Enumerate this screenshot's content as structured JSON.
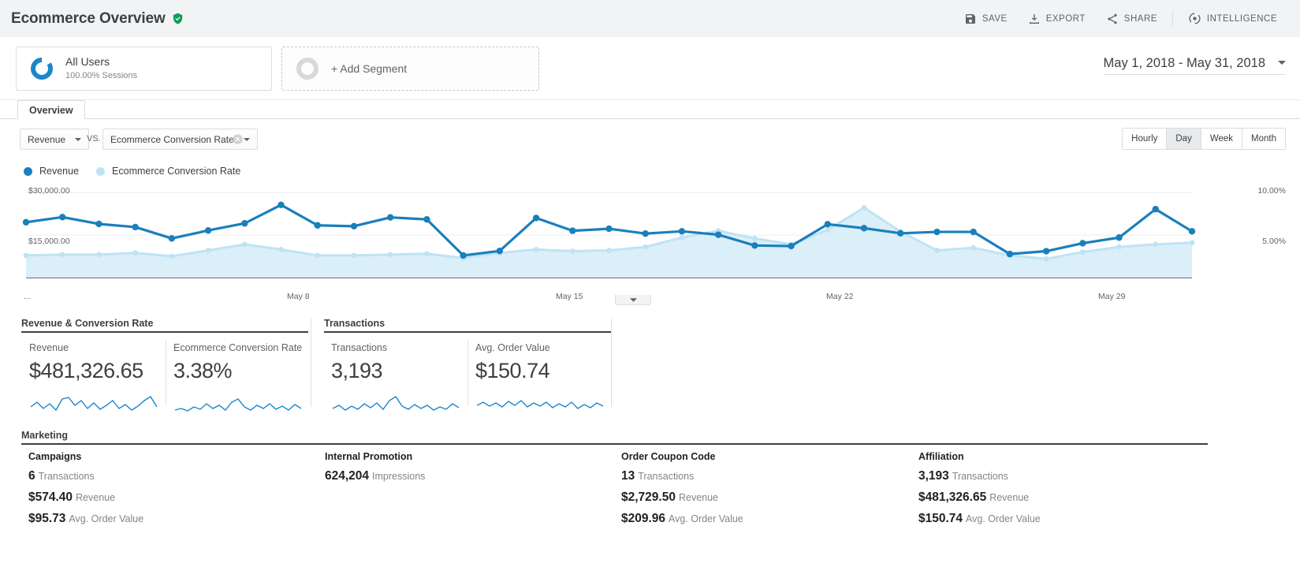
{
  "header": {
    "title": "Ecommerce Overview",
    "verified_icon": "verified-shield-icon",
    "actions": [
      {
        "label": "SAVE",
        "icon": "save-disk-icon"
      },
      {
        "label": "EXPORT",
        "icon": "export-download-icon"
      },
      {
        "label": "SHARE",
        "icon": "share-nodes-icon"
      },
      {
        "label": "INTELLIGENCE",
        "icon": "intelligence-sparkle-icon"
      }
    ]
  },
  "segments": {
    "all_users": {
      "title": "All Users",
      "subtitle": "100.00% Sessions",
      "icon": "donut-chart-icon"
    },
    "add_segment": {
      "label": "+ Add Segment",
      "icon": "empty-donut-icon"
    }
  },
  "date_range": {
    "value": "May 1, 2018 - May 31, 2018",
    "caret": "chevron-down-icon"
  },
  "tabs": [
    {
      "label": "Overview",
      "active": true
    }
  ],
  "controls": {
    "metric1": "Revenue",
    "vs": "VS.",
    "metric2": "Ecommerce Conversion Rate",
    "clear_icon": "clear-circle-icon",
    "granularity": [
      {
        "label": "Hourly",
        "active": false
      },
      {
        "label": "Day",
        "active": true
      },
      {
        "label": "Week",
        "active": false
      },
      {
        "label": "Month",
        "active": false
      }
    ]
  },
  "legend": [
    {
      "label": "Revenue",
      "color": "#1a7fbd"
    },
    {
      "label": "Ecommerce Conversion Rate",
      "color": "#bfe3f5"
    }
  ],
  "chart_data": {
    "type": "line",
    "title": "Revenue vs. Ecommerce Conversion Rate",
    "xlabel": "",
    "ylabel": "Revenue",
    "y2label": "Ecommerce Conversion Rate",
    "grid": true,
    "legend_position": "top-left",
    "ylim": [
      0,
      30000
    ],
    "y2lim": [
      0,
      10
    ],
    "y_ticks": [
      "$15,000.00",
      "$30,000.00"
    ],
    "y2_ticks": [
      "5.00%",
      "10.00%"
    ],
    "x_tick_labels": [
      "...",
      "May 8",
      "May 15",
      "May 22",
      "May 29"
    ],
    "x": [
      "May 1",
      "May 2",
      "May 3",
      "May 4",
      "May 5",
      "May 6",
      "May 7",
      "May 8",
      "May 9",
      "May 10",
      "May 11",
      "May 12",
      "May 13",
      "May 14",
      "May 15",
      "May 16",
      "May 17",
      "May 18",
      "May 19",
      "May 20",
      "May 21",
      "May 22",
      "May 23",
      "May 24",
      "May 25",
      "May 26",
      "May 27",
      "May 28",
      "May 29",
      "May 30",
      "May 31"
    ],
    "series": [
      {
        "name": "Revenue",
        "color": "#1a7fbd",
        "axis": "left",
        "values": [
          19500,
          21300,
          18900,
          17800,
          13800,
          16600,
          19100,
          25600,
          18400,
          18100,
          21200,
          20500,
          7800,
          9400,
          21000,
          16500,
          17200,
          15500,
          16300,
          15100,
          11300,
          11100,
          18800,
          17400,
          15600,
          16100,
          16100,
          8300,
          9300,
          12100,
          14100,
          24100,
          16300
        ]
      },
      {
        "name": "Ecommerce Conversion Rate",
        "color": "#bfe3f5",
        "axis": "right",
        "values": [
          2.6,
          2.7,
          2.7,
          2.9,
          2.5,
          3.2,
          3.9,
          3.3,
          2.6,
          2.6,
          2.7,
          2.8,
          2.3,
          2.9,
          3.3,
          3.1,
          3.2,
          3.6,
          4.7,
          5.5,
          4.6,
          3.9,
          5.6,
          8.2,
          5.4,
          3.2,
          3.5,
          2.6,
          2.2,
          3.0,
          3.6,
          3.9,
          4.1
        ]
      }
    ]
  },
  "sections": {
    "revenue_conversion": {
      "title": "Revenue & Conversion Rate",
      "cards": [
        {
          "name": "Revenue",
          "value": "$481,326.65"
        },
        {
          "name": "Ecommerce Conversion Rate",
          "value": "3.38%"
        }
      ]
    },
    "transactions": {
      "title": "Transactions",
      "cards": [
        {
          "name": "Transactions",
          "value": "3,193"
        },
        {
          "name": "Avg. Order Value",
          "value": "$150.74"
        }
      ]
    },
    "marketing": {
      "title": "Marketing",
      "columns": [
        {
          "heading": "Campaigns",
          "rows": [
            {
              "value": "6",
              "label": "Transactions"
            },
            {
              "value": "$574.40",
              "label": "Revenue"
            },
            {
              "value": "$95.73",
              "label": "Avg. Order Value"
            }
          ]
        },
        {
          "heading": "Internal Promotion",
          "rows": [
            {
              "value": "624,204",
              "label": "Impressions"
            }
          ]
        },
        {
          "heading": "Order Coupon Code",
          "rows": [
            {
              "value": "13",
              "label": "Transactions"
            },
            {
              "value": "$2,729.50",
              "label": "Revenue"
            },
            {
              "value": "$209.96",
              "label": "Avg. Order Value"
            }
          ]
        },
        {
          "heading": "Affiliation",
          "rows": [
            {
              "value": "3,193",
              "label": "Transactions"
            },
            {
              "value": "$481,326.65",
              "label": "Revenue"
            },
            {
              "value": "$150.74",
              "label": "Avg. Order Value"
            }
          ]
        }
      ]
    }
  }
}
